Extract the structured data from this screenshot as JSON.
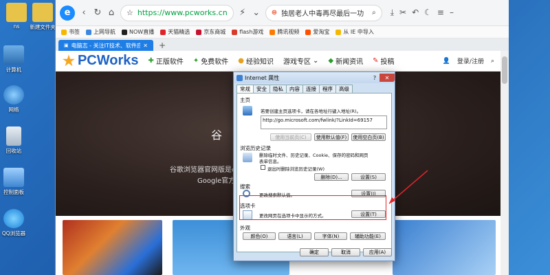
{
  "desktop": {
    "icons": [
      {
        "label": "ns"
      },
      {
        "label": "新建文件夹"
      },
      {
        "label": "计算机"
      },
      {
        "label": "网络"
      },
      {
        "label": "回收站"
      },
      {
        "label": "控制面板"
      },
      {
        "label": "QQ浏览器"
      }
    ]
  },
  "browser": {
    "url": "https://www.pcworks.cn",
    "search_text": "独居老人中毒再尽最后一功",
    "bookmarks": [
      "书签",
      "上网导航",
      "NOW直播",
      "天猫精选",
      "京东商城",
      "flash游戏",
      "腾讯视频",
      "爱淘宝",
      "从 IE 中导入"
    ],
    "tab_title": "电脑志 - 关注IT技术、软件应用、科",
    "new_tab_symbol": "+"
  },
  "site": {
    "logo": "PCWorks",
    "nav": [
      "正版软件",
      "免费软件",
      "经验知识",
      "游戏专区",
      "新闻资讯",
      "投稿"
    ],
    "login": "登录/注册",
    "hero_line1": "谷歌浏览器官网版是chr",
    "hero_line2": "Google官方稳",
    "hero_char": "谷"
  },
  "dialog": {
    "title": "Internet 属性",
    "tabs": [
      "常规",
      "安全",
      "隐私",
      "内容",
      "连接",
      "程序",
      "高级"
    ],
    "home": {
      "label": "主页",
      "desc": "若要创建主页选项卡，请在各地址行键入地址(R)。",
      "url": "http://go.microsoft.com/fwlink/?LinkId=69157",
      "btn_current": "使用当前页(C)",
      "btn_default": "使用默认值(F)",
      "btn_blank": "使用空白页(B)"
    },
    "history": {
      "label": "浏览历史记录",
      "desc1": "删除临时文件、历史记录、Cookie、保存的密码和网页",
      "desc2": "表单信息。",
      "checkbox": "退出时删除浏览历史记录(W)",
      "btn_delete": "删除(D)...",
      "btn_settings": "设置(S)"
    },
    "search": {
      "label": "搜索",
      "desc": "更改搜索默认值。",
      "btn_settings": "设置(I)"
    },
    "tabs_section": {
      "label": "选项卡",
      "desc": "更改网页在选项卡中显示的方式。",
      "btn_settings": "设置(T)"
    },
    "appearance": {
      "label": "外观",
      "btn_colors": "颜色(O)",
      "btn_languages": "语言(L)",
      "btn_fonts": "字体(N)",
      "btn_accessibility": "辅助功能(E)"
    },
    "footer": {
      "ok": "确定",
      "cancel": "取消",
      "apply": "应用(A)"
    }
  },
  "colors": {
    "highlight": "#e0252a",
    "accent": "#1f7ee6"
  }
}
